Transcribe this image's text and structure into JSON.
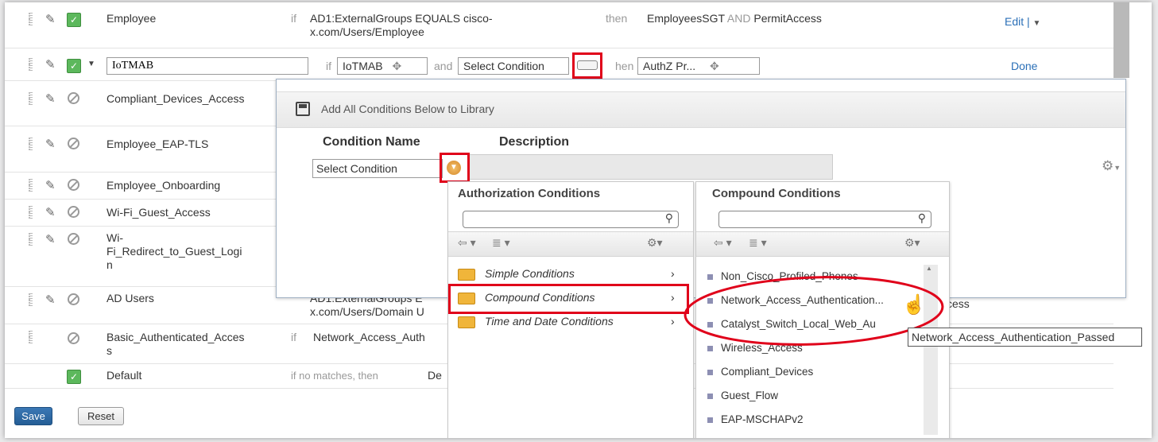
{
  "rules": [
    {
      "name": "Employee",
      "if": "if",
      "condition": "AD1:ExternalGroups EQUALS cisco-",
      "condition2": "x.com/Users/Employee",
      "then": "then",
      "result_a": "EmployeesSGT",
      "and": "AND",
      "result_b": "PermitAccess",
      "action": "Edit |"
    },
    {
      "name": "IoTMAB",
      "if": "if",
      "cond_value": "IoTMAB",
      "and": "and",
      "select": "Select Condition",
      "then": "hen",
      "authz": "AuthZ Pr...",
      "action": "Done"
    },
    {
      "name": "Compliant_Devices_Access"
    },
    {
      "name": "Employee_EAP-TLS"
    },
    {
      "name": "Employee_Onboarding"
    },
    {
      "name": "Wi-Fi_Guest_Access"
    },
    {
      "name_l1": "Wi-",
      "name_l2": "Fi_Redirect_to_Guest_Logi",
      "name_l3": "n"
    },
    {
      "name": "AD Users",
      "condition": "AD1:ExternalGroups E",
      "condition2": "x.com/Users/Domain U",
      "tail": "ccess"
    },
    {
      "name_l1": "Basic_Authenticated_Acces",
      "name_l2": "s",
      "if": "if",
      "condition": "Network_Access_Auth"
    },
    {
      "name": "Default",
      "if": "if no matches, then",
      "result": "De"
    }
  ],
  "buttons": {
    "save": "Save",
    "reset": "Reset"
  },
  "popup": {
    "add_library": "Add All Conditions Below to Library",
    "col_name": "Condition Name",
    "col_desc": "Description",
    "select": "Select Condition"
  },
  "auth_panel": {
    "title": "Authorization Conditions",
    "items": [
      "Simple Conditions",
      "Compound Conditions",
      "Time and Date Conditions"
    ]
  },
  "compound_panel": {
    "title": "Compound Conditions",
    "items": [
      "Non_Cisco_Profiled_Phones",
      "Network_Access_Authentication...",
      "Catalyst_Switch_Local_Web_Au",
      "Wireless_Access",
      "Compliant_Devices",
      "Guest_Flow",
      "EAP-MSCHAPv2"
    ]
  },
  "tooltip": "Network_Access_Authentication_Passed",
  "colors": {
    "accent": "#2a6fb7",
    "highlight": "#e0001a",
    "check": "#5cb85c"
  }
}
